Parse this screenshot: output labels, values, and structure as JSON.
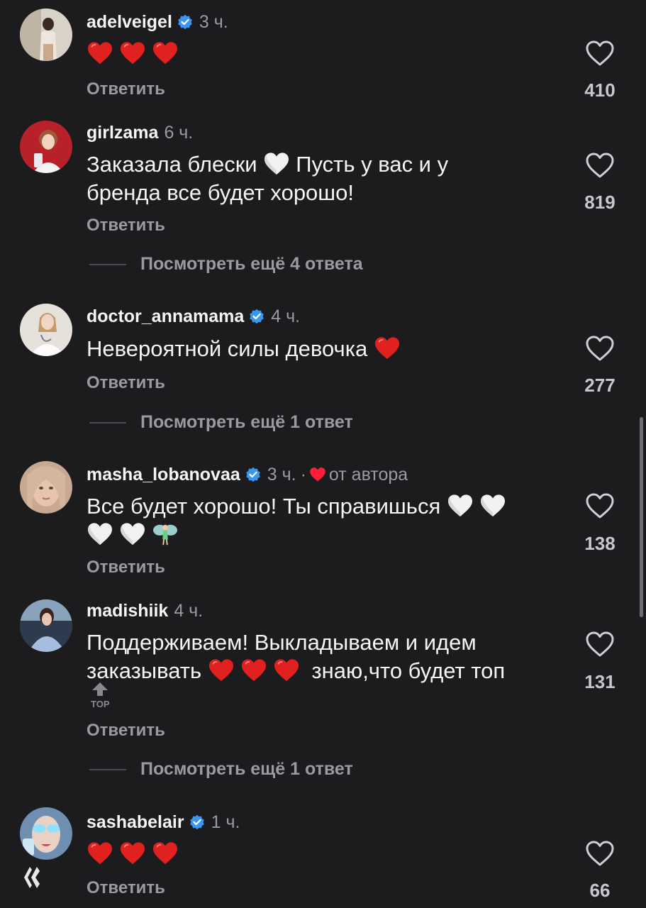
{
  "reply_label": "Ответить",
  "comments": [
    {
      "username": "adelveigel",
      "verified": true,
      "time": "3 ч.",
      "text": "",
      "emoji_hearts": "red",
      "hearts": 3,
      "likes": "410"
    },
    {
      "username": "girlzama",
      "verified": false,
      "time": "6 ч.",
      "text_line1": "Заказала блески",
      "text_line1b": "Пусть у вас и у",
      "text_line2": "бренда все будет хорошо!",
      "likes": "819",
      "more_replies": "Посмотреть ещё 4 ответа"
    },
    {
      "username": "doctor_annamama",
      "verified": true,
      "time": "4 ч.",
      "text": "Невероятной силы девочка",
      "likes": "277",
      "more_replies": "Посмотреть ещё 1 ответ"
    },
    {
      "username": "masha_lobanovaa",
      "verified": true,
      "time": "3 ч.",
      "dot": "·",
      "by_author": "от автора",
      "text": "Все будет хорошо! Ты справишься",
      "likes": "138"
    },
    {
      "username": "madishiik",
      "verified": false,
      "time": "4 ч.",
      "text_line1": "Поддерживаем! Выкладываем и идем",
      "text_line2a": "заказывать",
      "text_line2b": "знаю,что будет топ",
      "likes": "131",
      "more_replies": "Посмотреть ещё 1 ответ"
    },
    {
      "username": "sashabelair",
      "verified": true,
      "time": "1 ч.",
      "likes": "66"
    }
  ],
  "top_button": {
    "label": "TOP"
  },
  "colors": {
    "background": "#1c1c1e",
    "verified": "#3897f0",
    "heart_red": "#e0211f",
    "secondary": "#9a9a9f"
  }
}
